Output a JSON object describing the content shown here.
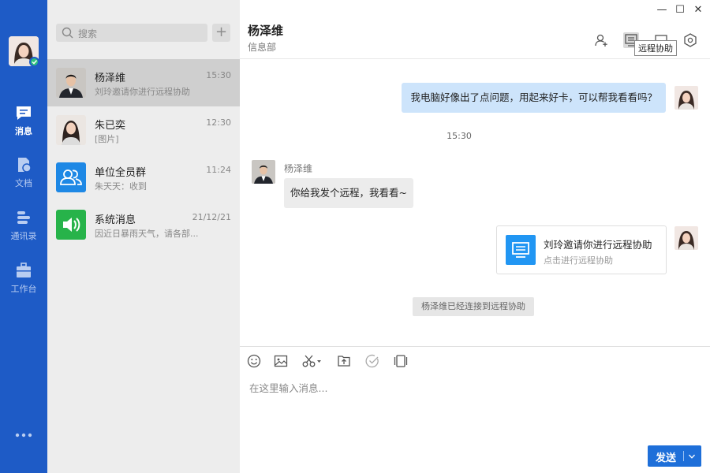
{
  "sidebar": {
    "items": [
      {
        "label": "消息",
        "icon": "chat-bubble-icon",
        "active": true
      },
      {
        "label": "文档",
        "icon": "document-icon",
        "active": false
      },
      {
        "label": "通讯录",
        "icon": "contacts-icon",
        "active": false
      },
      {
        "label": "工作台",
        "icon": "briefcase-icon",
        "active": false
      }
    ],
    "more_icon": "more-dots-icon",
    "status": "online"
  },
  "search": {
    "placeholder": "搜索"
  },
  "add_button": "+",
  "conversations": [
    {
      "name": "杨泽维",
      "time": "15:30",
      "preview": "刘玲邀请你进行远程协助",
      "selected": true,
      "avatar": "man-avatar"
    },
    {
      "name": "朱已奕",
      "time": "12:30",
      "preview": "[图片]",
      "selected": false,
      "avatar": "woman-avatar"
    },
    {
      "name": "单位全员群",
      "time": "11:24",
      "preview": "朱天天：收到",
      "selected": false,
      "avatar": "group-icon"
    },
    {
      "name": "系统消息",
      "time": "21/12/21",
      "preview": "因近日暴雨天气，请各部...",
      "selected": false,
      "avatar": "speaker-icon"
    }
  ],
  "chat": {
    "title": "杨泽维",
    "subtitle": "信息部",
    "tooltip": "远程协助",
    "header_icons": [
      "add-contact-icon",
      "remote-assist-icon",
      "window-icon",
      "settings-icon"
    ],
    "window_controls": {
      "minimize": "—",
      "maximize": "☐",
      "close": "✕"
    },
    "messages": [
      {
        "type": "outgoing-text",
        "text": "我电脑好像出了点问题，用起来好卡，可以帮我看看吗？"
      },
      {
        "type": "timestamp",
        "text": "15:30"
      },
      {
        "type": "incoming-text",
        "sender": "杨泽维",
        "text": "你给我发个远程，我看看~"
      },
      {
        "type": "outgoing-card",
        "title": "刘玲邀请你进行远程协助",
        "subtitle": "点击进行远程协助"
      },
      {
        "type": "system",
        "text": "杨泽维已经连接到远程协助"
      }
    ],
    "toolbar_icons": [
      "emoji-icon",
      "image-icon",
      "scissors-icon",
      "upload-file-icon",
      "check-circle-icon",
      "screen-record-icon"
    ],
    "input_placeholder": "在这里输入消息...",
    "send_label": "发送"
  },
  "colors": {
    "rail": "#1e5bc6",
    "accent": "#1e6fd9",
    "outgoing_bubble": "#cde4fb",
    "online": "#2ec27e",
    "group_icon_bg": "#1e88e5",
    "system_icon_bg": "#27b34a"
  }
}
